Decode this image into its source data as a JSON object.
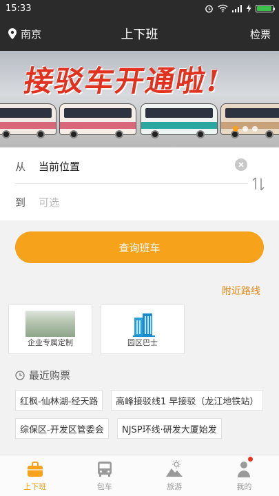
{
  "status_bar": {
    "time": "15:33"
  },
  "header": {
    "city": "南京",
    "title": "上下班",
    "right_action": "检票"
  },
  "banner": {
    "headline": "接驳车开通啦!",
    "slides": 3,
    "active_slide": 1
  },
  "route_form": {
    "from_label": "从",
    "from_value": "当前位置",
    "to_label": "到",
    "to_placeholder": "可选"
  },
  "query_button": "查询班车",
  "nearby_link": "附近路线",
  "services": [
    {
      "label": "企业专属定制"
    },
    {
      "label": "园区巴士"
    }
  ],
  "recent": {
    "title": "最近购票",
    "tickets": [
      "红枫-仙林湖-经天路",
      "高峰接驳线1 早接驳（龙江地铁站）",
      "综保区-开发区管委会",
      "NJSP环线·研发大厦始发"
    ]
  },
  "tabbar": {
    "items": [
      {
        "label": "上下班",
        "icon": "briefcase-icon",
        "active": true
      },
      {
        "label": "包车",
        "icon": "bus-icon",
        "active": false
      },
      {
        "label": "旅游",
        "icon": "mountain-sun-icon",
        "active": false
      },
      {
        "label": "我的",
        "icon": "person-icon",
        "active": false,
        "badge": true
      }
    ]
  },
  "colors": {
    "accent": "#f6a21a",
    "nav_bg": "#2b2b2b",
    "link": "#e08a14",
    "badge": "#e8341c"
  }
}
